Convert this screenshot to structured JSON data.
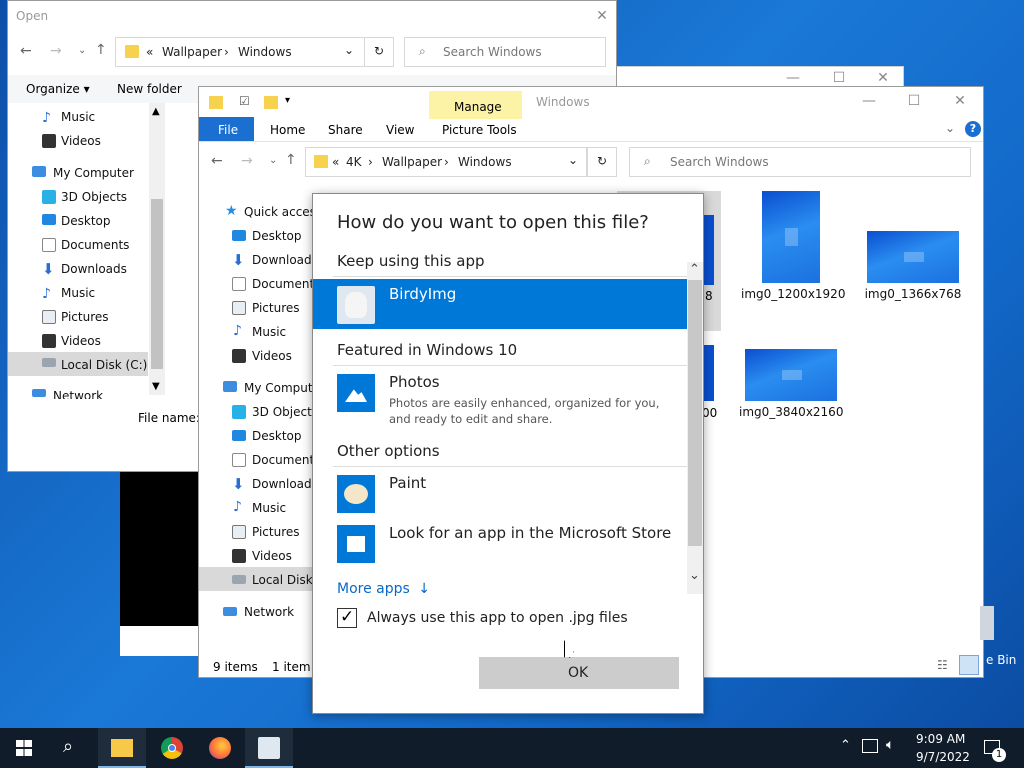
{
  "open_dialog": {
    "title": "Open",
    "breadcrumb": [
      "«",
      "Wallpaper",
      "Windows"
    ],
    "search_placeholder": "Search Windows",
    "toolbar": {
      "organize": "Organize",
      "new_folder": "New folder"
    },
    "tree": [
      "Music",
      "Videos",
      "My Computer",
      "3D Objects",
      "Desktop",
      "Documents",
      "Downloads",
      "Music",
      "Pictures",
      "Videos",
      "Local Disk (C:)",
      "Network"
    ],
    "file_name_label": "File name:"
  },
  "explorer": {
    "title": "Windows",
    "context_tab": "Manage",
    "tabs": [
      "File",
      "Home",
      "Share",
      "View",
      "Picture Tools"
    ],
    "breadcrumb": [
      "«",
      "4K",
      "Wallpaper",
      "Windows"
    ],
    "search_placeholder": "Search Windows",
    "nav": [
      "Quick access",
      "Desktop",
      "Downloads",
      "Documents",
      "Pictures",
      "Music",
      "Videos",
      "My Computer",
      "3D Objects",
      "Desktop",
      "Documents",
      "Downloads",
      "Music",
      "Pictures",
      "Videos",
      "Local Disk (",
      "Network"
    ],
    "files": [
      {
        "name": "img0_1200x1920"
      },
      {
        "name": "img0_1366x768"
      },
      {
        "name": "img0_3840x2160"
      }
    ],
    "partial_labels": [
      "8",
      "00"
    ],
    "status": {
      "items": "9 items",
      "selected": "1 item s"
    },
    "recycle_bin_partial": "e Bin"
  },
  "open_with": {
    "heading": "How do you want to open this file?",
    "keep_using": "Keep using this app",
    "current_app": "BirdyImg",
    "featured_heading": "Featured in Windows 10",
    "featured_app": {
      "name": "Photos",
      "description": "Photos are easily enhanced, organized for you, and ready to edit and share."
    },
    "other_heading": "Other options",
    "other_apps": [
      "Paint",
      "Look for an app in the Microsoft Store"
    ],
    "more_apps": "More apps",
    "always_use": "Always use this app to open .jpg files",
    "always_use_checked": true,
    "ok_label": "OK"
  },
  "taskbar": {
    "time": "9:09 AM",
    "date": "9/7/2022",
    "notification_count": "1"
  },
  "colors": {
    "accent": "#0078d7",
    "selected_row": "#0078d7",
    "context_tab": "#fcf3a6",
    "desktop": "#1a6fd0"
  }
}
